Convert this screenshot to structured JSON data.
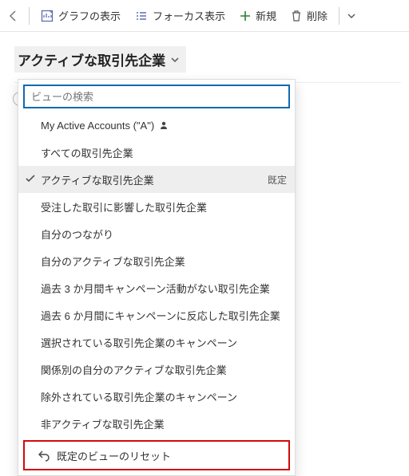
{
  "toolbar": {
    "show_chart_label": "グラフの表示",
    "focus_label": "フォーカス表示",
    "new_label": "新規",
    "delete_label": "削除"
  },
  "view_selector": {
    "title": "アクティブな取引先企業"
  },
  "search": {
    "placeholder": "ビューの検索"
  },
  "default_badge": "既定",
  "views": [
    {
      "label": "My Active Accounts (\"A\")",
      "personal": true
    },
    {
      "label": "すべての取引先企業"
    },
    {
      "label": "アクティブな取引先企業",
      "selected": true,
      "default": true
    },
    {
      "label": "受注した取引に影響した取引先企業"
    },
    {
      "label": "自分のつながり"
    },
    {
      "label": "自分のアクティブな取引先企業"
    },
    {
      "label": "過去 3 か月間キャンペーン活動がない取引先企業"
    },
    {
      "label": "過去 6 か月間にキャンペーンに反応した取引先企業"
    },
    {
      "label": "選択されている取引先企業のキャンペーン"
    },
    {
      "label": "関係別の自分のアクティブな取引先企業"
    },
    {
      "label": "除外されている取引先企業のキャンペーン"
    },
    {
      "label": "非アクティブな取引先企業"
    }
  ],
  "reset_label": "既定のビューのリセット"
}
